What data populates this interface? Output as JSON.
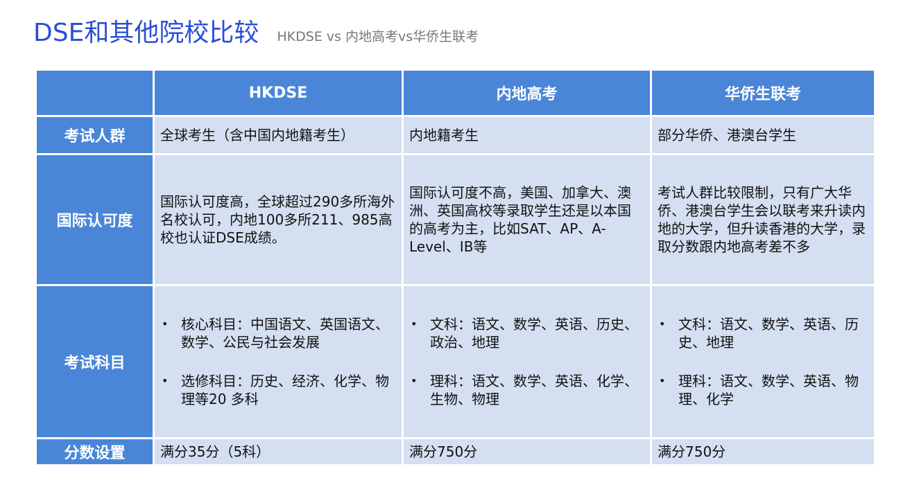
{
  "header": {
    "title": "DSE和其他院校比较",
    "subtitle": "HKDSE vs 内地高考vs华侨生联考"
  },
  "table": {
    "columns": [
      "",
      "HKDSE",
      "内地高考",
      "华侨生联考"
    ],
    "rows": [
      {
        "label": "考试人群",
        "cells": [
          "全球考生（含中国内地籍考生）",
          "内地籍考生",
          "部分华侨、港澳台学生"
        ]
      },
      {
        "label": "国际认可度",
        "cells": [
          "国际认可度高，全球超过290多所海外名校认可，内地100多所211、985高校也认证DSE成绩。",
          "国际认可度不高，美国、加拿大、澳洲、英国高校等录取学生还是以本国的高考为主，比如SAT、AP、A-Level、IB等",
          "考试人群比较限制，只有广大华侨、港澳台学生会以联考来升读内地的大学，但升读香港的大学，录取分数跟内地高考差不多"
        ]
      },
      {
        "label": "考试科目",
        "bullets": [
          [
            "核心科目：中国语文、英国语文、数学、公民与社会发展",
            "选修科目：历史、经济、化学、物理等20 多科"
          ],
          [
            "文科：语文、数学、英语、历史、政治、地理",
            "理科：语文、数学、英语、化学、生物、物理"
          ],
          [
            "文科：语文、数学、英语、历史、地理",
            "理科：语文、数学、英语、物理、化学"
          ]
        ]
      },
      {
        "label": "分数设置",
        "cells": [
          "满分35分（5科）",
          "满分750分",
          "满分750分"
        ]
      }
    ],
    "bullet_char": "•"
  },
  "colors": {
    "title": "#2a4fd6",
    "header_bg": "#4a86d8",
    "cell_bg": "#d4dff1"
  }
}
